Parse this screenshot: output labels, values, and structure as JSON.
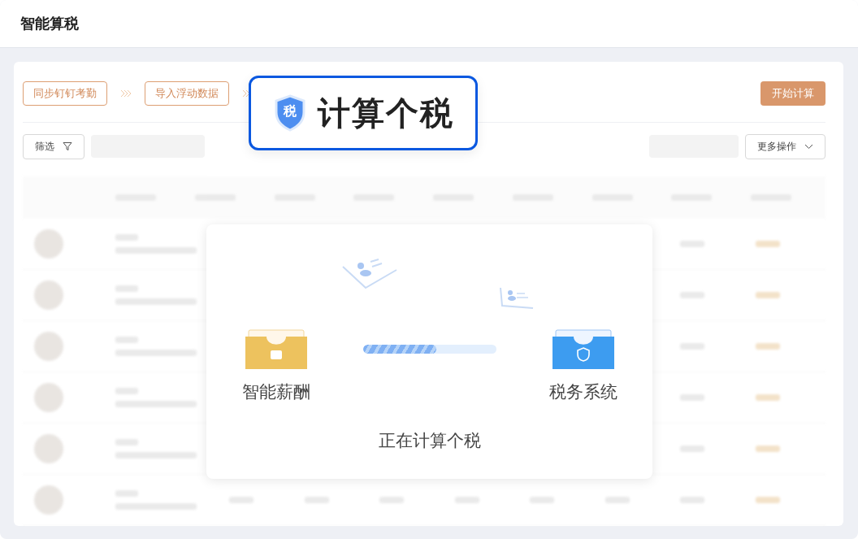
{
  "header": {
    "title": "智能算税"
  },
  "steps": [
    {
      "label": "同步钉钉考勤"
    },
    {
      "label": "导入浮动数据"
    }
  ],
  "callout": {
    "badge": "税",
    "label": "计算个税"
  },
  "toolbar": {
    "filter": "筛选",
    "start": "开始计算",
    "more": "更多操作"
  },
  "dialog": {
    "source": "智能薪酬",
    "target": "税务系统",
    "level": 0.55,
    "status": "正在计算个税"
  }
}
